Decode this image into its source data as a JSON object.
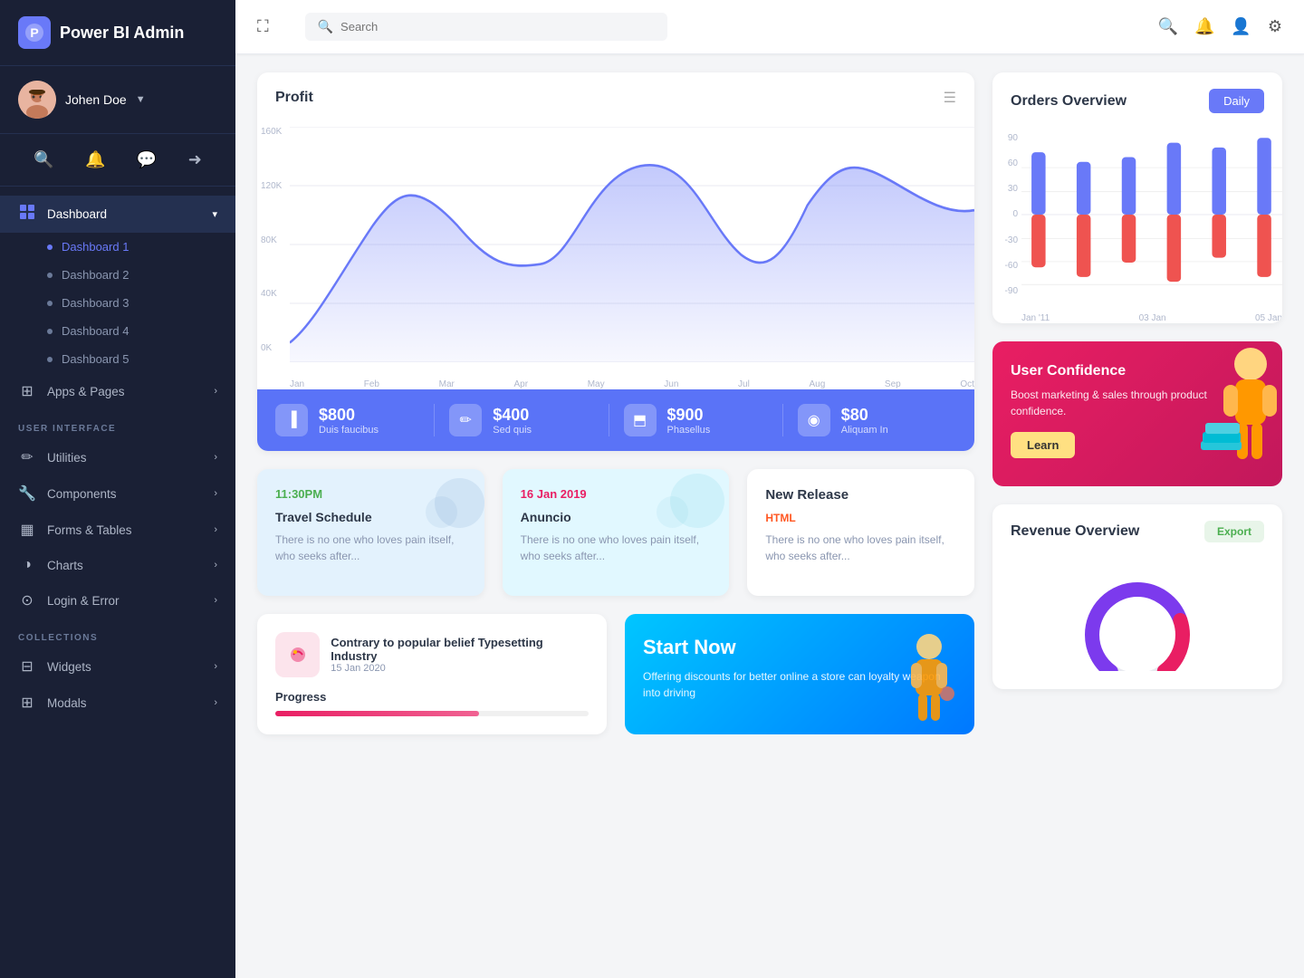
{
  "brand": {
    "name": "Power BI Admin",
    "icon": "⬡"
  },
  "user": {
    "name": "Johen Doe",
    "avatar": "👦"
  },
  "sidebar": {
    "main_nav": [
      {
        "label": "Dashboard",
        "icon": "⊞",
        "expanded": true
      },
      {
        "label": "Dashboard 1",
        "active": true
      },
      {
        "label": "Dashboard 2"
      },
      {
        "label": "Dashboard 3"
      },
      {
        "label": "Dashboard 4"
      },
      {
        "label": "Dashboard 5"
      },
      {
        "label": "Apps & Pages",
        "icon": "⊞",
        "arrow": true
      }
    ],
    "ui_section_title": "USER INTERFACE",
    "ui_nav": [
      {
        "label": "Utilities",
        "icon": "✏",
        "arrow": true
      },
      {
        "label": "Components",
        "icon": "🔧",
        "arrow": true
      },
      {
        "label": "Forms & Tables",
        "icon": "▦",
        "arrow": true
      },
      {
        "label": "Charts",
        "icon": "◑",
        "arrow": true
      },
      {
        "label": "Login & Error",
        "icon": "⊙",
        "arrow": true
      }
    ],
    "collections_title": "COLLECTIONS",
    "collections_nav": [
      {
        "label": "Widgets",
        "icon": "⊟",
        "arrow": true
      },
      {
        "label": "Modals",
        "icon": "⊞",
        "arrow": true
      }
    ]
  },
  "topbar": {
    "search_placeholder": "Search",
    "expand_icon": "⛶"
  },
  "profit_chart": {
    "title": "Profit",
    "menu_icon": "☰",
    "y_labels": [
      "160K",
      "120K",
      "80K",
      "40K",
      "0K"
    ],
    "x_labels": [
      "Jan",
      "Feb",
      "Mar",
      "Apr",
      "May",
      "Jun",
      "Jul",
      "Aug",
      "Sep",
      "Oct"
    ]
  },
  "stats": [
    {
      "value": "$800",
      "label": "Duis faucibus",
      "icon": "▐"
    },
    {
      "value": "$400",
      "label": "Sed quis",
      "icon": "✏"
    },
    {
      "value": "$900",
      "label": "Phasellus",
      "icon": "⬒"
    },
    {
      "value": "$80",
      "label": "Aliquam In",
      "icon": "🔵"
    }
  ],
  "info_cards": [
    {
      "type": "travel",
      "time": "11:30PM",
      "title": "Travel Schedule",
      "text": "There is no one who loves pain itself, who seeks after..."
    },
    {
      "type": "anuncio",
      "time": "16 Jan 2019",
      "title": "Anuncio",
      "text": "There is no one who loves pain itself, who seeks after..."
    },
    {
      "type": "new_release",
      "badge": "HTML",
      "title": "New Release",
      "text": "There is no one who loves pain itself, who seeks after..."
    }
  ],
  "news_card": {
    "title": "Contrary to popular belief Typesetting Industry",
    "date": "15 Jan 2020",
    "text": "",
    "progress_label": "Progress",
    "progress_value": 65
  },
  "start_now": {
    "title": "Start Now",
    "text": "Offering discounts for better online a store can loyalty weapon into driving"
  },
  "orders_overview": {
    "title": "Orders Overview",
    "btn_label": "Daily",
    "y_labels": [
      "90",
      "60",
      "30",
      "0",
      "-30",
      "-60",
      "-90"
    ],
    "x_labels": [
      "Jan '11",
      "03 Jan",
      "05 Jan"
    ]
  },
  "user_confidence": {
    "title": "User Confidence",
    "text": "Boost marketing & sales through product confidence.",
    "btn_label": "Learn"
  },
  "revenue_overview": {
    "title": "Revenue Overview",
    "btn_label": "Export"
  }
}
